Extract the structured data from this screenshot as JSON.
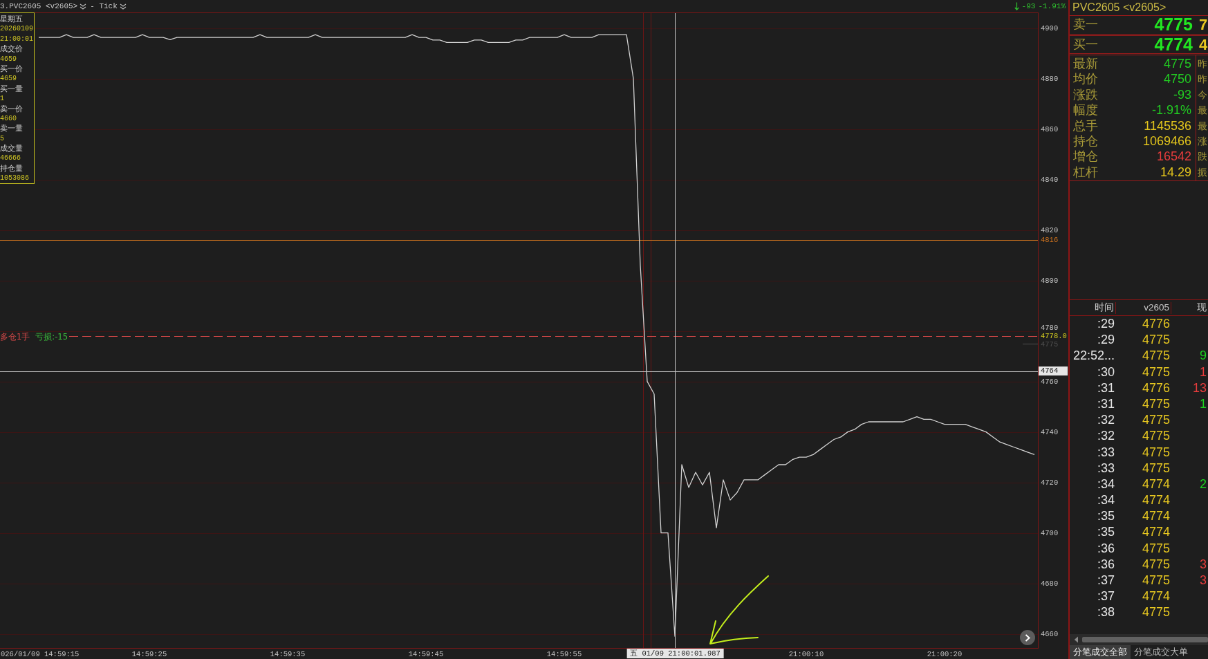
{
  "title_bar": {
    "symbol": "3.PVC2605 <v2605>",
    "period": "- Tick",
    "falling": true,
    "change": "-93",
    "change_pct": "-1.91%"
  },
  "chart": {
    "tooltip": [
      {
        "kind": "label",
        "text": "星期五"
      },
      {
        "kind": "value",
        "text": "20260109"
      },
      {
        "kind": "value",
        "text": "21:00:01"
      },
      {
        "kind": "label",
        "text": "成交价"
      },
      {
        "kind": "value",
        "text": "4659"
      },
      {
        "kind": "label",
        "text": "买一价"
      },
      {
        "kind": "value",
        "text": "4659"
      },
      {
        "kind": "label",
        "text": "买一量"
      },
      {
        "kind": "value",
        "text": "1"
      },
      {
        "kind": "label",
        "text": "卖一价"
      },
      {
        "kind": "value",
        "text": "4660"
      },
      {
        "kind": "label",
        "text": "卖一量"
      },
      {
        "kind": "value",
        "text": "5"
      },
      {
        "kind": "label",
        "text": "成交量"
      },
      {
        "kind": "value",
        "text": "46666"
      },
      {
        "kind": "label",
        "text": "持仓量"
      },
      {
        "kind": "value",
        "text": "1053086"
      }
    ],
    "position": {
      "side": "多仓1手",
      "pnl": "亏损:-15"
    },
    "cursor_time": "五 01/09 21:00:01.987",
    "chart_data": {
      "type": "line",
      "grid": true,
      "categories": [
        "026/01/09 14:59:15",
        null,
        null,
        null,
        null,
        null,
        null,
        null,
        null,
        null,
        null,
        null,
        null,
        null,
        null,
        null,
        "14:59:25",
        null,
        null,
        null,
        null,
        null,
        null,
        null,
        null,
        null,
        null,
        null,
        null,
        null,
        null,
        null,
        null,
        null,
        null,
        null,
        "14:59:35",
        null,
        null,
        null,
        null,
        null,
        null,
        null,
        null,
        null,
        null,
        null,
        null,
        null,
        null,
        null,
        null,
        null,
        null,
        null,
        "14:59:45",
        null,
        null,
        null,
        null,
        null,
        null,
        null,
        null,
        null,
        null,
        null,
        null,
        null,
        null,
        null,
        null,
        null,
        null,
        null,
        "14:59:55",
        null,
        null,
        null,
        null,
        null,
        null,
        null,
        null,
        null,
        null,
        null,
        null,
        null,
        null,
        null,
        null,
        null,
        null,
        null,
        null,
        null,
        null,
        null,
        null,
        null,
        null,
        null,
        null,
        null,
        null,
        null,
        null,
        null,
        null,
        "21:00:10",
        null,
        null,
        null,
        null,
        null,
        null,
        null,
        null,
        null,
        null,
        null,
        null,
        null,
        null,
        null,
        null,
        null,
        null,
        null,
        "21:00:20",
        null,
        null,
        null,
        null,
        null,
        null,
        null,
        null,
        null,
        null,
        null,
        null,
        null
      ],
      "values": [
        4896.3,
        4896.3,
        4896.3,
        4896.3,
        4897.4,
        4896.3,
        4896.3,
        4896.3,
        4897.4,
        4896.3,
        4896.3,
        4896.3,
        4896.3,
        4896.3,
        4896.3,
        4897.4,
        4896.3,
        4896.3,
        4896.3,
        4895.4,
        4896.3,
        4896.3,
        4896.3,
        4896.3,
        4896.3,
        4896.3,
        4896.3,
        4896.3,
        4896.3,
        4896.3,
        4896.3,
        4896.3,
        4897.4,
        4896.3,
        4896.3,
        4896.3,
        4896.3,
        4896.3,
        4896.3,
        4896.3,
        4897.4,
        4896.3,
        4896.3,
        4896.3,
        4896.3,
        4896.3,
        4896.3,
        4896.3,
        4896.3,
        4896.3,
        4896.3,
        4896.3,
        4896.3,
        4896.3,
        4897.4,
        4896.3,
        4896.3,
        4895.3,
        4895.3,
        4894.3,
        4894.3,
        4894.3,
        4894.3,
        4895.3,
        4895.3,
        4894.3,
        4894.3,
        4894.3,
        4894.3,
        4895.3,
        4895.3,
        4896.3,
        4896.3,
        4896.3,
        4896.3,
        4896.3,
        4897.4,
        4896.3,
        4896.3,
        4896.3,
        4896.3,
        4897.4,
        4897.4,
        4897.4,
        4897.4,
        4897.4,
        4880,
        4806,
        4760,
        4755,
        4700,
        4700,
        4659,
        4727,
        4718,
        4724,
        4719,
        4724,
        4702,
        4721,
        4713,
        4716,
        4721,
        4721,
        4721,
        4723,
        4725,
        4727,
        4727,
        4729,
        4730,
        4730,
        4731,
        4733,
        4735,
        4737,
        4738,
        4740,
        4741,
        4743,
        4744,
        4744,
        4744,
        4744,
        4744,
        4744,
        4745,
        4746,
        4745,
        4745,
        4744,
        4743,
        4743,
        4743,
        4743,
        4742,
        4741,
        4740,
        4738,
        4736,
        4735,
        4734,
        4733,
        4732,
        4731
      ],
      "ylim": [
        4654.4,
        4906.2
      ],
      "yticks": [
        4660,
        4680,
        4700,
        4720,
        4740,
        4760,
        4780,
        4800,
        4820,
        4840,
        4860,
        4880,
        4900
      ],
      "ref_lines": [
        {
          "axis": "y",
          "value": 4816,
          "label": "4816",
          "color": "#d2741e"
        },
        {
          "axis": "y",
          "value": 4778,
          "label": "4778.0",
          "color": "#d84848"
        },
        {
          "axis": "y",
          "value": 4775,
          "label": "4775",
          "color": "#4e4e4e"
        },
        {
          "axis": "y",
          "value": 4764,
          "label": "4764",
          "color": "#c4c4c4"
        }
      ]
    }
  },
  "quote_panel": {
    "title": "PVC2605 <v2605>",
    "depth": [
      {
        "label": "卖一",
        "price": "4775",
        "column_3": "7"
      },
      {
        "label": "买一",
        "price": "4774",
        "column_3": "4"
      }
    ],
    "stats": [
      {
        "label": "最新",
        "value": "4775",
        "color": "#22cc22",
        "side_label": "昨"
      },
      {
        "label": "均价",
        "value": "4750",
        "color": "#22cc22",
        "side_label": "昨"
      },
      {
        "label": "涨跌",
        "value": "-93",
        "color": "#22cc22",
        "side_label": "今"
      },
      {
        "label": "幅度",
        "value": "-1.91%",
        "color": "#22cc22",
        "side_label": "最"
      },
      {
        "label": "总手",
        "value": "1145536",
        "color": "#e2c41c",
        "side_label": "最"
      },
      {
        "label": "持仓",
        "value": "1069466",
        "color": "#e2c41c",
        "side_label": "涨"
      },
      {
        "label": "增仓",
        "value": "16542",
        "color": "#e83c3c",
        "side_label": "跌"
      },
      {
        "label": "杠杆",
        "value": "14.29",
        "color": "#e2c41c",
        "side_label": "振"
      }
    ],
    "ticks": {
      "columns": [
        "时间",
        "v2605",
        "现"
      ],
      "rows": [
        {
          "time": ":29",
          "price": "4776"
        },
        {
          "time": ":29",
          "price": "4775"
        },
        {
          "time": "22:52...",
          "price": "4775",
          "volume": "9",
          "color": "#1ed21e"
        },
        {
          "time": ":30",
          "price": "4775",
          "volume": "1",
          "color": "#e83c3c"
        },
        {
          "time": ":31",
          "price": "4776",
          "volume": "13",
          "color": "#e83c3c"
        },
        {
          "time": ":31",
          "price": "4775",
          "volume": "1",
          "color": "#1ed21e"
        },
        {
          "time": ":32",
          "price": "4775"
        },
        {
          "time": ":32",
          "price": "4775"
        },
        {
          "time": ":33",
          "price": "4775"
        },
        {
          "time": ":33",
          "price": "4775"
        },
        {
          "time": ":34",
          "price": "4774",
          "volume": "2",
          "color": "#1ed21e"
        },
        {
          "time": ":34",
          "price": "4774"
        },
        {
          "time": ":35",
          "price": "4774"
        },
        {
          "time": ":35",
          "price": "4774"
        },
        {
          "time": ":36",
          "price": "4775"
        },
        {
          "time": ":36",
          "price": "4775",
          "volume": "3",
          "color": "#e83c3c"
        },
        {
          "time": ":37",
          "price": "4775",
          "volume": "3",
          "color": "#e83c3c"
        },
        {
          "time": ":37",
          "price": "4774"
        },
        {
          "time": ":38",
          "price": "4775"
        }
      ]
    },
    "tabs": [
      {
        "label": "分笔成交全部",
        "selected": true
      },
      {
        "label": "分笔成交大单",
        "selected": false
      }
    ]
  }
}
